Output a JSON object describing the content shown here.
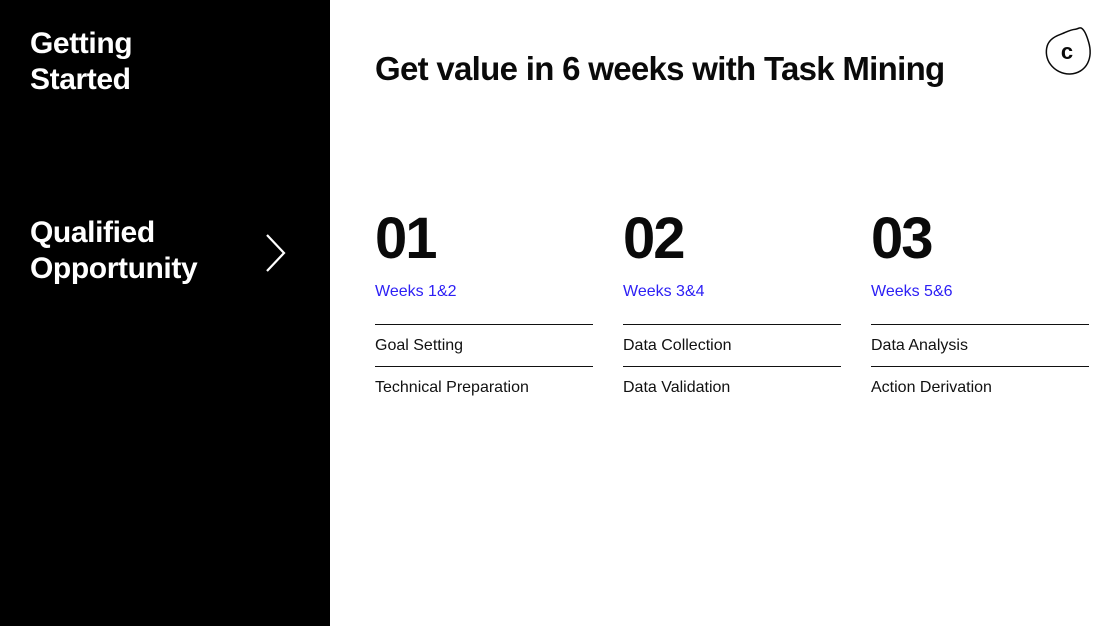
{
  "sidebar": {
    "kicker": "Getting\nStarted",
    "stage": "Qualified\nOpportunity",
    "chevron_icon": "chevron-right-icon",
    "background_color": "#000000",
    "text_color": "#ffffff"
  },
  "header": {
    "title": "Get value in 6 weeks with Task Mining",
    "brand_badge": {
      "icon": "celonis-blob-c-logo",
      "letter": "c"
    }
  },
  "colors": {
    "accent_blue": "#2d20f5",
    "text_black": "#0a0a0a",
    "rule": "#111111",
    "page_background": "#ffffff"
  },
  "columns": [
    {
      "number": "01",
      "weeks": "Weeks 1&2",
      "items": [
        "Goal Setting",
        "Technical Preparation"
      ]
    },
    {
      "number": "02",
      "weeks": "Weeks 3&4",
      "items": [
        "Data Collection",
        "Data Validation"
      ]
    },
    {
      "number": "03",
      "weeks": "Weeks 5&6",
      "items": [
        "Data Analysis",
        "Action Derivation"
      ]
    }
  ]
}
